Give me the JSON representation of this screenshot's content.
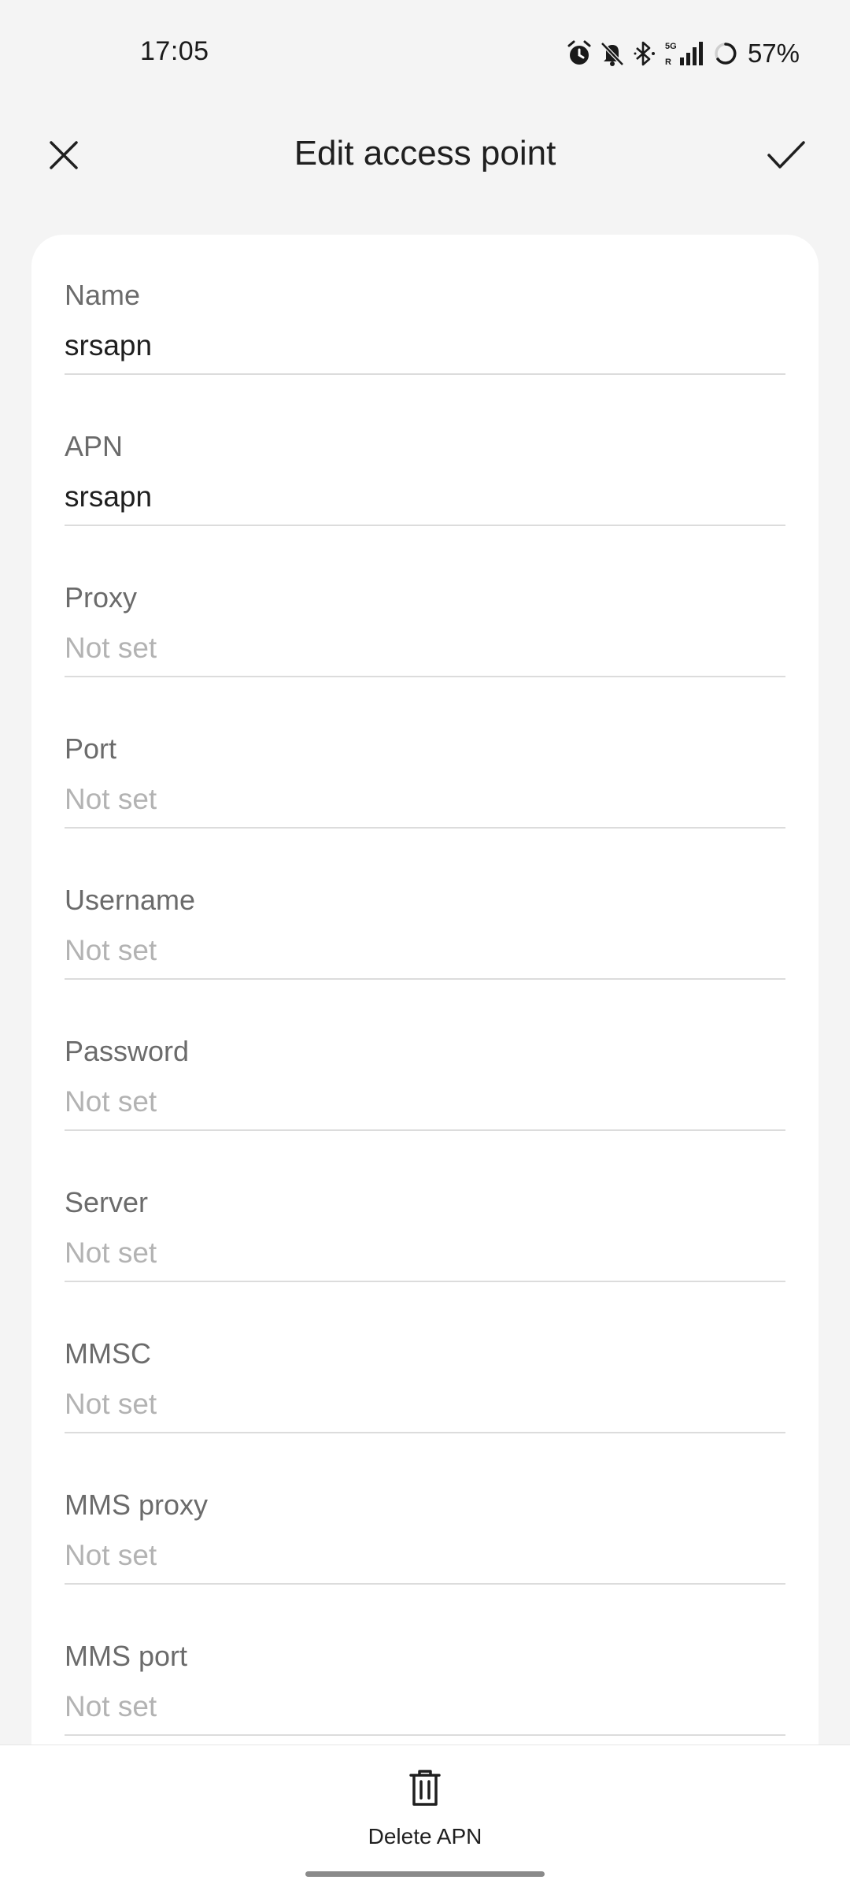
{
  "status_bar": {
    "time": "17:05",
    "battery": "57%",
    "icons": [
      "alarm-icon",
      "bell-muted-icon",
      "bluetooth-icon",
      "5g-signal-icon",
      "battery-ring-icon"
    ]
  },
  "header": {
    "title": "Edit access point",
    "close_icon": "close-icon",
    "confirm_icon": "check-icon"
  },
  "fields": [
    {
      "label": "Name",
      "value": "srsapn",
      "is_placeholder": false
    },
    {
      "label": "APN",
      "value": "srsapn",
      "is_placeholder": false
    },
    {
      "label": "Proxy",
      "value": "Not set",
      "is_placeholder": true
    },
    {
      "label": "Port",
      "value": "Not set",
      "is_placeholder": true
    },
    {
      "label": "Username",
      "value": "Not set",
      "is_placeholder": true
    },
    {
      "label": "Password",
      "value": "Not set",
      "is_placeholder": true
    },
    {
      "label": "Server",
      "value": "Not set",
      "is_placeholder": true
    },
    {
      "label": "MMSC",
      "value": "Not set",
      "is_placeholder": true
    },
    {
      "label": "MMS proxy",
      "value": "Not set",
      "is_placeholder": true
    },
    {
      "label": "MMS port",
      "value": "Not set",
      "is_placeholder": true
    }
  ],
  "bottom_bar": {
    "delete_label": "Delete APN",
    "delete_icon": "trash-icon"
  },
  "colors": {
    "background": "#f4f4f4",
    "card": "#ffffff",
    "label": "#6b6b6b",
    "value": "#1f1f1f",
    "placeholder": "#b3b3b3",
    "divider": "#dcdcdc"
  }
}
